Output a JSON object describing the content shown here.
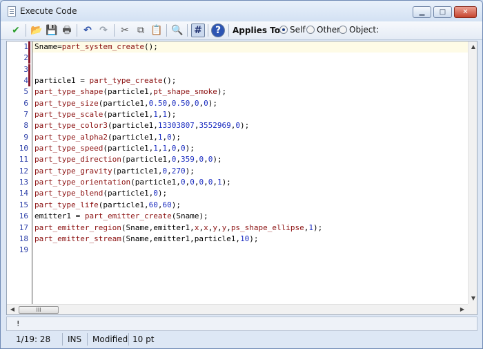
{
  "window": {
    "title": "Execute Code",
    "minimize_glyph": "▁",
    "maximize_glyph": "□",
    "close_glyph": "✕"
  },
  "toolbar": {
    "icons": [
      "checkmark-icon",
      "open-folder-icon",
      "save-icon",
      "print-icon",
      "undo-icon",
      "redo-icon",
      "cut-icon",
      "copy-icon",
      "paste-icon",
      "find-icon",
      "number-toggle-icon",
      "help-icon"
    ],
    "glyphs": {
      "check": "✔",
      "open": "📂",
      "save": "💾",
      "print": "🖶",
      "undo": "↶",
      "redo": "↷",
      "cut": "✂",
      "copy": "⧉",
      "paste": "📋",
      "find": "🔍",
      "numbers": "#",
      "help": "?"
    },
    "applies_to_label": "Applies To:",
    "options": [
      {
        "label": "Self",
        "selected": true
      },
      {
        "label": "Other",
        "selected": false
      },
      {
        "label": "Object:",
        "selected": false
      }
    ]
  },
  "editor": {
    "current_line": 1,
    "marked_lines": [
      1,
      2,
      3,
      4
    ],
    "lines": [
      {
        "n": "1",
        "tokens": [
          [
            "t",
            "Sname="
          ],
          [
            "fn",
            "part_system_create"
          ],
          [
            "t",
            "();"
          ]
        ]
      },
      {
        "n": "2",
        "tokens": []
      },
      {
        "n": "3",
        "tokens": []
      },
      {
        "n": "4",
        "tokens": [
          [
            "t",
            "particle1 = "
          ],
          [
            "fn",
            "part_type_create"
          ],
          [
            "t",
            "();"
          ]
        ]
      },
      {
        "n": "5",
        "tokens": [
          [
            "fn",
            "part_type_shape"
          ],
          [
            "t",
            "(particle1,"
          ],
          [
            "fn",
            "pt_shape_smoke"
          ],
          [
            "t",
            ");"
          ]
        ]
      },
      {
        "n": "6",
        "tokens": [
          [
            "fn",
            "part_type_size"
          ],
          [
            "t",
            "(particle1,"
          ],
          [
            "num",
            "0.50"
          ],
          [
            "t",
            ","
          ],
          [
            "num",
            "0.50"
          ],
          [
            "t",
            ","
          ],
          [
            "num",
            "0"
          ],
          [
            "t",
            ","
          ],
          [
            "num",
            "0"
          ],
          [
            "t",
            ");"
          ]
        ]
      },
      {
        "n": "7",
        "tokens": [
          [
            "fn",
            "part_type_scale"
          ],
          [
            "t",
            "(particle1,"
          ],
          [
            "num",
            "1"
          ],
          [
            "t",
            ","
          ],
          [
            "num",
            "1"
          ],
          [
            "t",
            ");"
          ]
        ]
      },
      {
        "n": "8",
        "tokens": [
          [
            "fn",
            "part_type_color3"
          ],
          [
            "t",
            "(particle1,"
          ],
          [
            "num",
            "13303807"
          ],
          [
            "t",
            ","
          ],
          [
            "num",
            "3552969"
          ],
          [
            "t",
            ","
          ],
          [
            "num",
            "0"
          ],
          [
            "t",
            ");"
          ]
        ]
      },
      {
        "n": "9",
        "tokens": [
          [
            "fn",
            "part_type_alpha2"
          ],
          [
            "t",
            "(particle1,"
          ],
          [
            "num",
            "1"
          ],
          [
            "t",
            ","
          ],
          [
            "num",
            "0"
          ],
          [
            "t",
            ");"
          ]
        ]
      },
      {
        "n": "10",
        "tokens": [
          [
            "fn",
            "part_type_speed"
          ],
          [
            "t",
            "(particle1,"
          ],
          [
            "num",
            "1"
          ],
          [
            "t",
            ","
          ],
          [
            "num",
            "1"
          ],
          [
            "t",
            ","
          ],
          [
            "num",
            "0"
          ],
          [
            "t",
            ","
          ],
          [
            "num",
            "0"
          ],
          [
            "t",
            ");"
          ]
        ]
      },
      {
        "n": "11",
        "tokens": [
          [
            "fn",
            "part_type_direction"
          ],
          [
            "t",
            "(particle1,"
          ],
          [
            "num",
            "0"
          ],
          [
            "t",
            ","
          ],
          [
            "num",
            "359"
          ],
          [
            "t",
            ","
          ],
          [
            "num",
            "0"
          ],
          [
            "t",
            ","
          ],
          [
            "num",
            "0"
          ],
          [
            "t",
            ");"
          ]
        ]
      },
      {
        "n": "12",
        "tokens": [
          [
            "fn",
            "part_type_gravity"
          ],
          [
            "t",
            "(particle1,"
          ],
          [
            "num",
            "0"
          ],
          [
            "t",
            ","
          ],
          [
            "num",
            "270"
          ],
          [
            "t",
            ");"
          ]
        ]
      },
      {
        "n": "13",
        "tokens": [
          [
            "fn",
            "part_type_orientation"
          ],
          [
            "t",
            "(particle1,"
          ],
          [
            "num",
            "0"
          ],
          [
            "t",
            ","
          ],
          [
            "num",
            "0"
          ],
          [
            "t",
            ","
          ],
          [
            "num",
            "0"
          ],
          [
            "t",
            ","
          ],
          [
            "num",
            "0"
          ],
          [
            "t",
            ","
          ],
          [
            "num",
            "1"
          ],
          [
            "t",
            ");"
          ]
        ]
      },
      {
        "n": "14",
        "tokens": [
          [
            "fn",
            "part_type_blend"
          ],
          [
            "t",
            "(particle1,"
          ],
          [
            "num",
            "0"
          ],
          [
            "t",
            ");"
          ]
        ]
      },
      {
        "n": "15",
        "tokens": [
          [
            "fn",
            "part_type_life"
          ],
          [
            "t",
            "(particle1,"
          ],
          [
            "num",
            "60"
          ],
          [
            "t",
            ","
          ],
          [
            "num",
            "60"
          ],
          [
            "t",
            ");"
          ]
        ]
      },
      {
        "n": "16",
        "tokens": [
          [
            "t",
            "emitter1 = "
          ],
          [
            "fn",
            "part_emitter_create"
          ],
          [
            "t",
            "(Sname);"
          ]
        ]
      },
      {
        "n": "17",
        "tokens": [
          [
            "fn",
            "part_emitter_region"
          ],
          [
            "t",
            "(Sname,emitter1,"
          ],
          [
            "fn",
            "x"
          ],
          [
            "t",
            ","
          ],
          [
            "fn",
            "x"
          ],
          [
            "t",
            ","
          ],
          [
            "fn",
            "y"
          ],
          [
            "t",
            ","
          ],
          [
            "fn",
            "y"
          ],
          [
            "t",
            ","
          ],
          [
            "fn",
            "ps_shape_ellipse"
          ],
          [
            "t",
            ","
          ],
          [
            "num",
            "1"
          ],
          [
            "t",
            ");"
          ]
        ]
      },
      {
        "n": "18",
        "tokens": [
          [
            "fn",
            "part_emitter_stream"
          ],
          [
            "t",
            "(Sname,emitter1,particle1,"
          ],
          [
            "num",
            "10"
          ],
          [
            "t",
            ");"
          ]
        ]
      },
      {
        "n": "19",
        "tokens": []
      }
    ],
    "scroll_up": "▲",
    "scroll_down": "▼",
    "scroll_left": "◀",
    "scroll_right": "▶",
    "thumb_grip": "III"
  },
  "message_bar": "!",
  "status": {
    "position": "1/19:  28",
    "mode": "INS",
    "state": "Modified",
    "font_size": "10 pt"
  },
  "colors": {
    "function": "#8b1010",
    "number": "#1a2cc0",
    "line_number": "#2b3ea8",
    "current_line_bg": "#fefbe6",
    "marker": "#8b1a2e"
  }
}
